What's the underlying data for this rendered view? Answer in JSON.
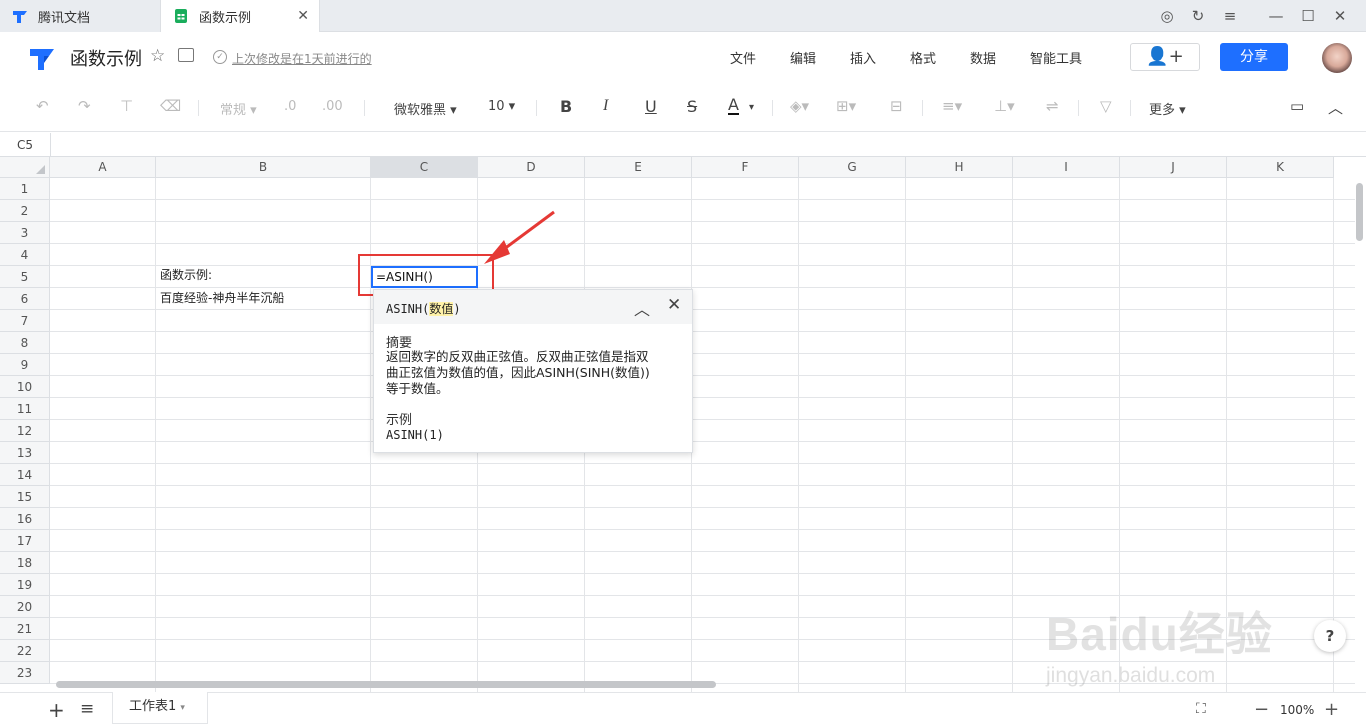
{
  "browser": {
    "tabs": [
      {
        "label": "腾讯文档"
      },
      {
        "label": "函数示例"
      }
    ]
  },
  "header": {
    "doc_title": "函数示例",
    "saved_status": "上次修改是在1天前进行的",
    "menu": [
      "文件",
      "编辑",
      "插入",
      "格式",
      "数据",
      "智能工具"
    ],
    "share_label": "分享"
  },
  "toolbar": {
    "number_format": "常规",
    "font_family": "微软雅黑",
    "font_size": "10",
    "more_label": "更多"
  },
  "formula_bar": {
    "cell_ref": "C5"
  },
  "grid": {
    "columns": [
      "A",
      "B",
      "C",
      "D",
      "E",
      "F",
      "G",
      "H",
      "I",
      "J",
      "K"
    ],
    "rows": [
      "1",
      "2",
      "3",
      "4",
      "5",
      "6",
      "7",
      "8",
      "9",
      "10",
      "11",
      "12",
      "13",
      "14",
      "15",
      "16",
      "17",
      "18",
      "19",
      "20",
      "21",
      "22",
      "23"
    ],
    "cells": {
      "B5": "函数示例:",
      "B6": "百度经验-神舟半年沉船",
      "C5": "=ASINH()"
    }
  },
  "function_tip": {
    "sig_prefix": "ASINH(",
    "sig_arg": "数值",
    "sig_suffix": ")",
    "summary_title": "摘要",
    "summary_line1": "返回数字的反双曲正弦值。反双曲正弦值是指双",
    "summary_line2": "曲正弦值为数值的值，因此ASINH(SINH(数值))",
    "summary_line3": "等于数值。",
    "example_title": "示例",
    "example": "ASINH(1)"
  },
  "sheets": {
    "active": "工作表1"
  },
  "zoom": "100%",
  "watermark": {
    "brand": "Baidu经验",
    "url": "jingyan.baidu.com"
  },
  "colors": {
    "accent": "#1e6fff",
    "highlight_box": "#e53935"
  }
}
